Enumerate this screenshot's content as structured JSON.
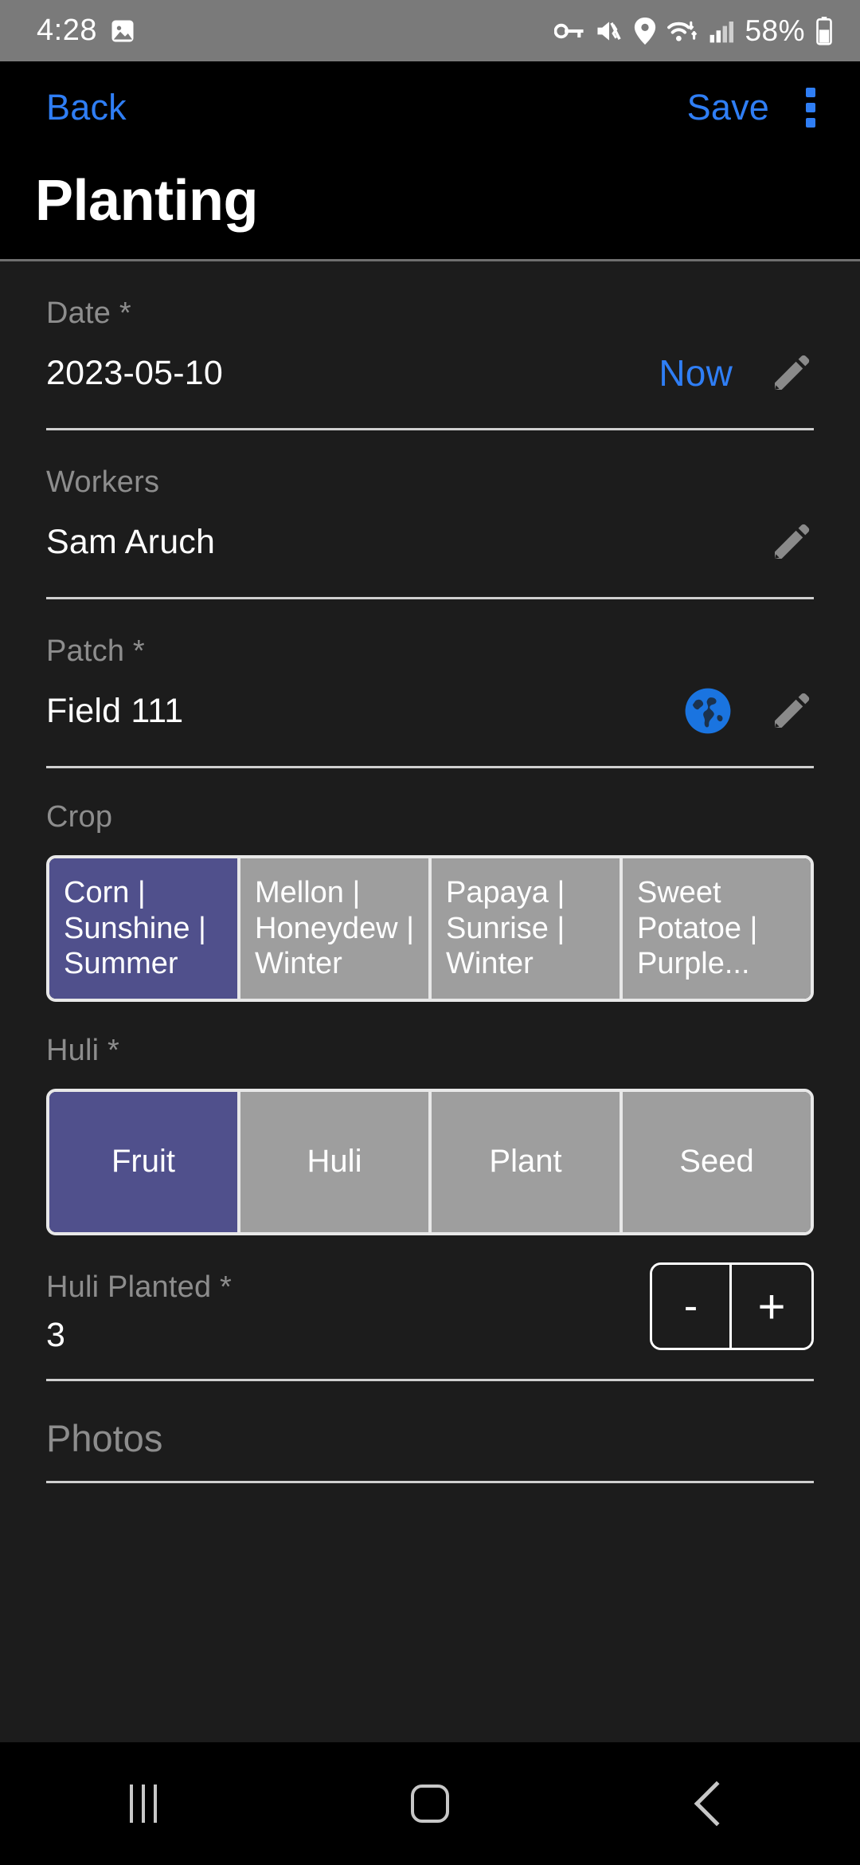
{
  "status_bar": {
    "time": "4:28",
    "battery": "58%",
    "left_icons": [
      "screenshot-image-icon"
    ],
    "right_icons": [
      "vpn-key-icon",
      "mute-icon",
      "location-pin-icon",
      "wifi-icon",
      "cellular-signal-icon",
      "battery-icon"
    ]
  },
  "app_bar": {
    "back_label": "Back",
    "save_label": "Save",
    "overflow_icon": "kebab-menu-icon",
    "title": "Planting",
    "accent_color": "#2f7ef5"
  },
  "form": {
    "date": {
      "label": "Date *",
      "value": "2023-05-10",
      "now_label": "Now",
      "edit_icon": "pencil-icon"
    },
    "workers": {
      "label": "Workers",
      "value": "Sam Aruch",
      "edit_icon": "pencil-icon"
    },
    "patch": {
      "label": "Patch *",
      "value": "Field 111",
      "map_icon": "globe-icon",
      "edit_icon": "pencil-icon"
    },
    "crop": {
      "label": "Crop",
      "options": [
        {
          "label": "Corn | Sunshine | Summer",
          "selected": true
        },
        {
          "label": "Mellon | Honeydew | Winter",
          "selected": false
        },
        {
          "label": "Papaya | Sunrise | Winter",
          "selected": false
        },
        {
          "label": "Sweet Potatoe | Purple...",
          "selected": false
        }
      ]
    },
    "huli": {
      "label": "Huli *",
      "options": [
        {
          "label": "Fruit",
          "selected": true
        },
        {
          "label": "Huli",
          "selected": false
        },
        {
          "label": "Plant",
          "selected": false
        },
        {
          "label": "Seed",
          "selected": false
        }
      ]
    },
    "huli_planted": {
      "label": "Huli Planted *",
      "value": "3",
      "decrement_label": "-",
      "increment_label": "+"
    },
    "photos": {
      "label": "Photos"
    }
  },
  "colors": {
    "selected_segment": "#50508c",
    "unselected_segment": "#9e9e9e",
    "accent_blue": "#2f7ef5",
    "label_gray": "#8d8d8d",
    "background": "#1c1c1c"
  },
  "nav_bar": {
    "recents_icon": "recents-icon",
    "home_icon": "home-icon",
    "back_icon": "back-chevron-icon"
  }
}
